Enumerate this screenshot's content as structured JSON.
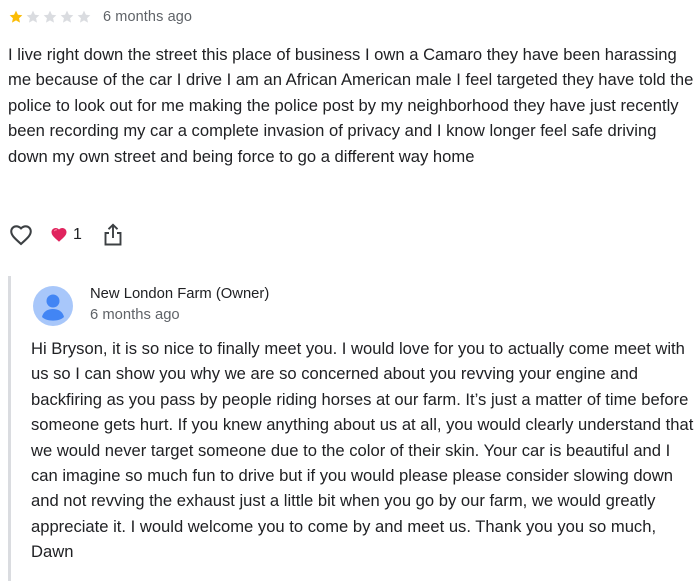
{
  "review": {
    "rating": 1,
    "max_rating": 5,
    "time": "6 months ago",
    "text": "I live right down the street this place of business I own a Camaro they have been harassing me because of the car I drive I am an African American male I feel targeted they have told the police to look out for me making the police post by my neighborhood they have just recently been recording my car a complete invasion of privacy and I know longer feel safe driving down my own street and being force to go a different way home"
  },
  "actions": {
    "like_icon": "heart-outline-icon",
    "reaction_icon": "red-heart-emoji",
    "reaction_count": "1",
    "share_icon": "share-icon"
  },
  "reply": {
    "owner_name": "New London Farm (Owner)",
    "time": "6 months ago",
    "text": "Hi Bryson, it is so nice to finally meet you. I would love for you to actually come meet with us so I can show you why we are so concerned about you revving your engine and backfiring as you pass by people riding horses at our farm. It’s just a matter of time before someone gets hurt. If you knew anything about us at all, you would clearly understand that we would never target someone due to the color of their skin. Your car is beautiful and I can imagine so much fun to drive but if you would please please consider slowing down and not revving the exhaust just a little bit when you go by our farm, we would greatly appreciate it. I would welcome you to come by and meet us. Thank you you so much, Dawn"
  },
  "colors": {
    "star_filled": "#fbbc04",
    "star_empty": "#dadce0",
    "secondary_text": "#5f6368",
    "avatar_bg": "#a8c7fa",
    "avatar_fg": "#4285f4",
    "reaction_red": "#e0245e",
    "divider": "#dadce0"
  }
}
